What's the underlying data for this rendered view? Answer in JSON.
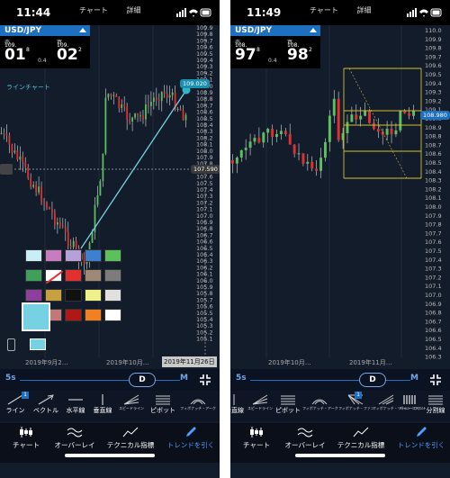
{
  "left": {
    "clock": "11:44",
    "tabs": [
      "チャート",
      "詳細"
    ],
    "pair": "USD/JPY",
    "sell": {
      "label": "売",
      "int": "109.",
      "main": "01",
      "sup": "8"
    },
    "buy": {
      "label": "買",
      "int": "109.",
      "main": "02",
      "sup": "2"
    },
    "spread": "0.4",
    "chart_type_label": "ラインチャート",
    "yaxis": [
      "109.9",
      "109.8",
      "109.7",
      "109.6",
      "109.5",
      "109.4",
      "109.3",
      "109.2",
      "109.1",
      "109.0",
      "108.9",
      "108.8",
      "108.7",
      "108.6",
      "108.5",
      "108.4",
      "108.3",
      "108.2",
      "108.1",
      "108.0",
      "107.9",
      "107.8",
      "107.7",
      "107.6",
      "107.5",
      "107.4",
      "107.3",
      "107.2",
      "107.1",
      "107.0",
      "106.9",
      "106.8",
      "106.7",
      "106.6",
      "106.5",
      "106.4",
      "106.3",
      "106.2",
      "106.1",
      "106.0",
      "105.9",
      "105.8",
      "105.7",
      "105.6",
      "105.5",
      "105.4",
      "105.3",
      "105.2",
      "105.1"
    ],
    "price_tag": "109.020",
    "crosshair_tag": "107.590",
    "dates": [
      "2019年9月2…",
      "2019年10月…"
    ],
    "date_box": "2019年11月26日",
    "slider": {
      "left": "5s",
      "knob": "D",
      "right": "M"
    },
    "tools": [
      "ライン",
      "ベクトル",
      "水平線",
      "垂直線",
      "スピードライン",
      "ピボット",
      "フィボナッチ・アーク"
    ],
    "tool_badge": "1"
  },
  "right": {
    "clock": "11:49",
    "tabs": [
      "チャート",
      "詳細"
    ],
    "pair": "USD/JPY",
    "sell": {
      "label": "売",
      "int": "108.",
      "main": "97",
      "sup": "8"
    },
    "buy": {
      "label": "買",
      "int": "108.",
      "main": "98",
      "sup": "2"
    },
    "spread": "0.4",
    "yaxis": [
      "110.0",
      "109.9",
      "109.8",
      "109.7",
      "109.6",
      "109.5",
      "109.4",
      "109.3",
      "109.2",
      "109.1",
      "109.0",
      "108.9",
      "108.8",
      "108.7",
      "108.6",
      "108.5",
      "108.4",
      "108.3",
      "108.2",
      "108.1",
      "108.0",
      "107.9",
      "107.8",
      "107.7",
      "107.6",
      "107.5",
      "107.4",
      "107.3",
      "107.2",
      "107.1",
      "107.0",
      "106.9",
      "106.8",
      "106.7",
      "106.6",
      "106.5",
      "106.4",
      "106.3"
    ],
    "price_tag": "108.980",
    "dates": [
      "2019年10月…",
      "2019年11月…"
    ],
    "slider": {
      "left": "5s",
      "knob": "D",
      "right": "M"
    },
    "tools": [
      "垂直線",
      "スピードライン",
      "ピボット",
      "フィボナッチ・アーク",
      "フィボナッチ・ファン",
      "フィボナッチ・リトレースメント",
      "ギャン・ファン",
      "分割線"
    ],
    "tool_badge": "1"
  },
  "nav": [
    "チャート",
    "オーバーレイ",
    "テクニカル指標",
    "トレンドを引く"
  ],
  "palette": [
    "#c8eef8",
    "#c77cc0",
    "#b7a0d8",
    "#3f7fd0",
    "#5cc05c",
    "#3fa05c",
    "#ffffff",
    "#e03030",
    "#a08878",
    "#7c7c7c",
    "#8c3f9c",
    "#c8a040",
    "#101010",
    "#f0f088",
    "#e0e0e0",
    "#a8e038",
    "#c07878",
    "#b01818",
    "#f08020",
    "#ffffff"
  ]
}
